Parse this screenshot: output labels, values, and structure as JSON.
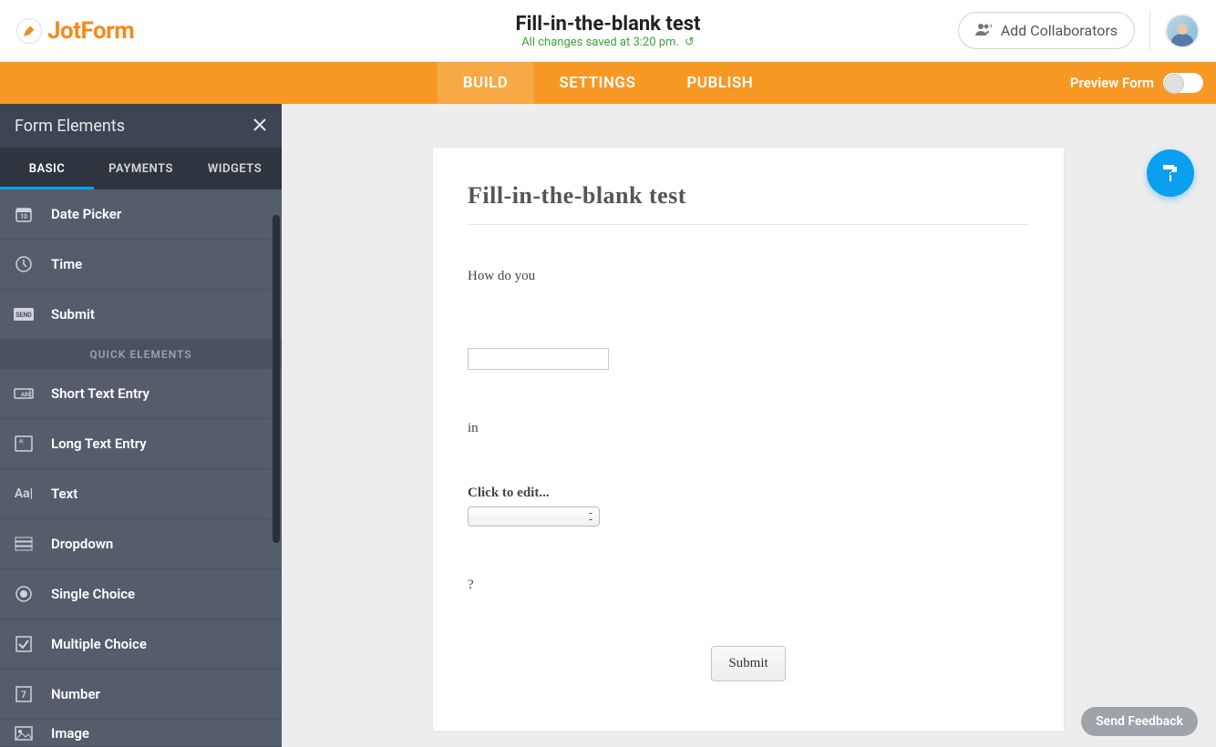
{
  "header": {
    "logo_text": "JotForm",
    "form_title": "Fill-in-the-blank test",
    "save_status": "All changes saved at 3:20 pm.",
    "collaborators_button": "Add Collaborators"
  },
  "navbar": {
    "tabs": [
      "BUILD",
      "SETTINGS",
      "PUBLISH"
    ],
    "preview_label": "Preview Form"
  },
  "sidebar": {
    "title": "Form Elements",
    "tabs": [
      "BASIC",
      "PAYMENTS",
      "WIDGETS"
    ],
    "section_header": "QUICK ELEMENTS",
    "items_top": [
      {
        "label": "Date Picker",
        "icon": "calendar"
      },
      {
        "label": "Time",
        "icon": "clock"
      },
      {
        "label": "Submit",
        "icon": "send"
      }
    ],
    "items_quick": [
      {
        "label": "Short Text Entry",
        "icon": "abc-box"
      },
      {
        "label": "Long Text Entry",
        "icon": "textarea"
      },
      {
        "label": "Text",
        "icon": "Aa"
      },
      {
        "label": "Dropdown",
        "icon": "rows"
      },
      {
        "label": "Single Choice",
        "icon": "radio"
      },
      {
        "label": "Multiple Choice",
        "icon": "check"
      },
      {
        "label": "Number",
        "icon": "seven"
      },
      {
        "label": "Image",
        "icon": "image"
      }
    ]
  },
  "form": {
    "title": "Fill-in-the-blank test",
    "q1": "How do you",
    "q2": "in",
    "q3_label": "Click to edit...",
    "q4": "?",
    "submit": "Submit"
  },
  "footer": {
    "feedback": "Send Feedback"
  }
}
